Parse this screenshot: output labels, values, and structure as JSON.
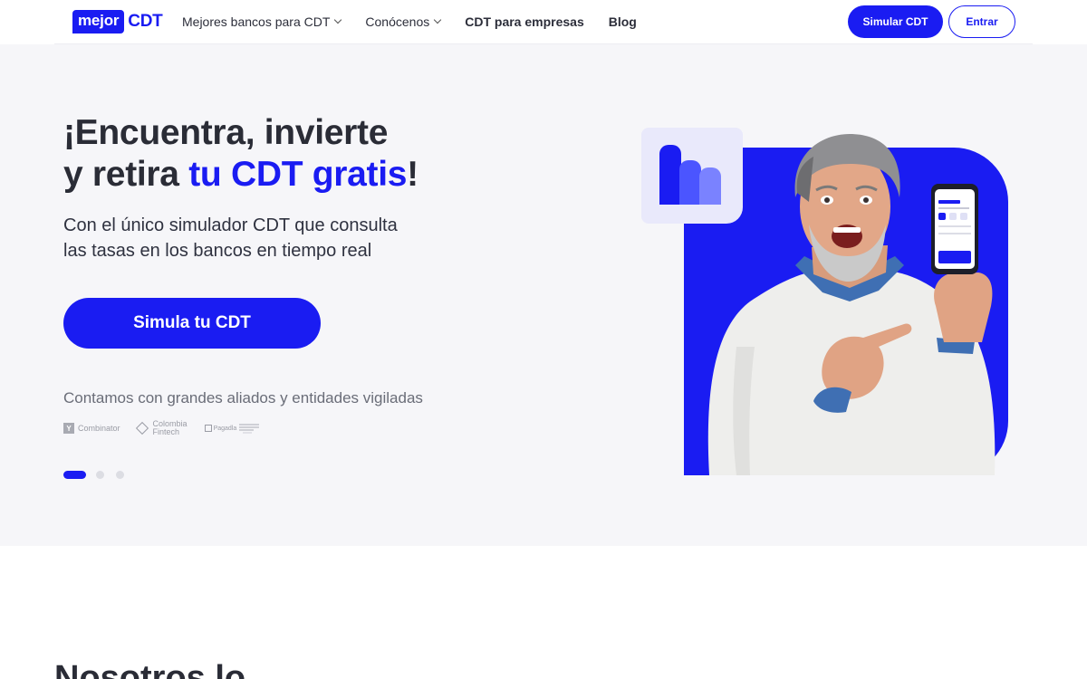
{
  "header": {
    "logo": {
      "badge": "mejor",
      "text": "CDT"
    },
    "nav": [
      {
        "label": "Mejores bancos para CDT",
        "has_dropdown": true
      },
      {
        "label": "Conócenos",
        "has_dropdown": true
      },
      {
        "label": "CDT para empresas",
        "has_dropdown": false
      },
      {
        "label": "Blog",
        "has_dropdown": false
      }
    ],
    "simulate_button": "Simular CDT",
    "login_button": "Entrar"
  },
  "hero": {
    "title_line1": "¡Encuentra, invierte",
    "title_line2_prefix": "y retira ",
    "title_line2_accent": "tu CDT gratis",
    "title_line2_suffix": "!",
    "subtitle_line1": "Con el único simulador CDT que consulta",
    "subtitle_line2": "las tasas en los bancos en tiempo real",
    "cta": "Simula tu CDT",
    "allies_text": "Contamos con grandes aliados y entidades vigiladas",
    "partners": {
      "yc_mark": "Y",
      "yc_name": "Combinator",
      "fintech_line1": "Colombia",
      "fintech_line2": "Fintech",
      "pg_name": "Pagadla"
    },
    "carousel": {
      "slides": 3,
      "active": 1
    }
  },
  "next_section": {
    "title": "Nosotros lo"
  },
  "colors": {
    "brand": "#1a1cf2",
    "hero_bg": "#f6f6f9",
    "text": "#2a2c36"
  }
}
